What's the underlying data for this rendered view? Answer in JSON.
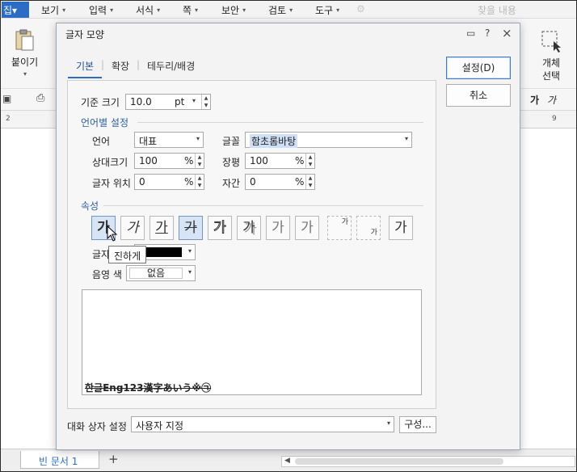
{
  "menu": {
    "items": [
      "집",
      "보기",
      "입력",
      "서식",
      "쪽",
      "보안",
      "검토",
      "도구"
    ],
    "search_hint": "찾을 내용"
  },
  "toolbar": {
    "paste_label": "붙이기",
    "object_select_label_1": "개체",
    "object_select_label_2": "선택",
    "font_sample_1": "가",
    "font_sample_2": "가"
  },
  "ruler": {
    "left_mark": "2",
    "right_mark": "9"
  },
  "dialog": {
    "title": "글자 모양",
    "help": "?",
    "close": "×",
    "tabs": [
      "기본",
      "확장",
      "테두리/배경"
    ],
    "active_tab": "기본",
    "base_size": {
      "label": "기준 크기",
      "value": "10.0",
      "unit": "pt"
    },
    "lang_section": "언어별 설정",
    "language": {
      "label": "언어",
      "value": "대표"
    },
    "font": {
      "label": "글꼴",
      "value": "함초롬바탕"
    },
    "relative_size": {
      "label": "상대크기",
      "value": "100",
      "unit": "%"
    },
    "width_ratio": {
      "label": "장평",
      "value": "100",
      "unit": "%"
    },
    "position": {
      "label": "글자 위치",
      "value": "0",
      "unit": "%"
    },
    "spacing": {
      "label": "자간",
      "value": "0",
      "unit": "%"
    },
    "attr_section": "속성",
    "attr_buttons": [
      "가",
      "가",
      "가",
      "가",
      "가",
      "가",
      "가",
      "가",
      "가",
      "가",
      "가"
    ],
    "tooltip": "진하게",
    "text_color_label": "글자",
    "shade_color": {
      "label": "음영 색",
      "value": "없음"
    },
    "preview_text": "한글Eng123漢字あいう※㉠",
    "dialog_setting": {
      "label": "대화 상자 설정",
      "value": "사용자 지정"
    },
    "compose_button": "구성...",
    "ok_button": "설정(D)",
    "cancel_button": "취소"
  },
  "status": {
    "doc_tab": "빈 문서 1",
    "add_tab": "+"
  },
  "colors": {
    "accent": "#2b6cc4",
    "text_color": "#000000",
    "section": "#2a5ea8"
  }
}
